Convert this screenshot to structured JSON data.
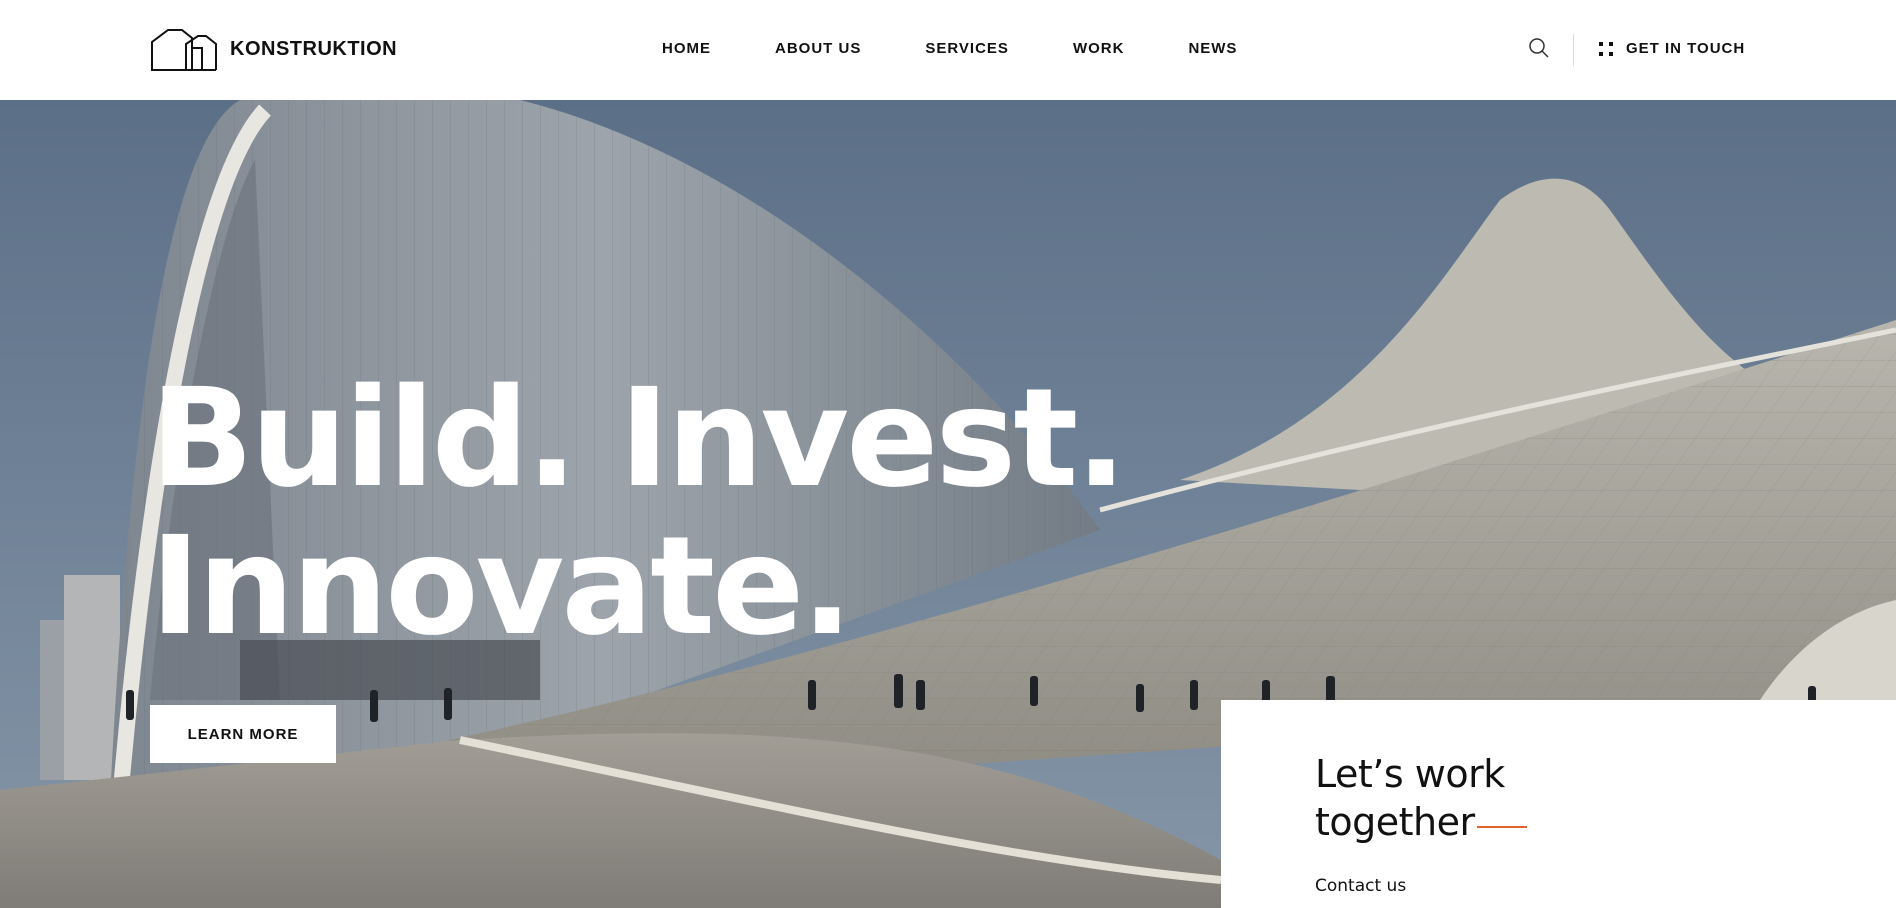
{
  "brand": {
    "name": "KONSTRUKTION"
  },
  "nav": {
    "items": [
      {
        "label": "HOME"
      },
      {
        "label": "ABOUT US"
      },
      {
        "label": "SERVICES"
      },
      {
        "label": "WORK"
      },
      {
        "label": "NEWS"
      }
    ]
  },
  "header": {
    "search_icon": "search-icon",
    "cta_icon": "four-dots-icon",
    "cta_label": "GET IN TOUCH"
  },
  "hero": {
    "headline_line1": "Build. Invest.",
    "headline_line2": "Innovate.",
    "button_label": "LEARN MORE",
    "background": "photo of curved white architecture against blue sky"
  },
  "card": {
    "title_line1": "Let’s work",
    "title_line2": "together",
    "link_label": "Contact us",
    "accent_color": "#e0622d"
  }
}
